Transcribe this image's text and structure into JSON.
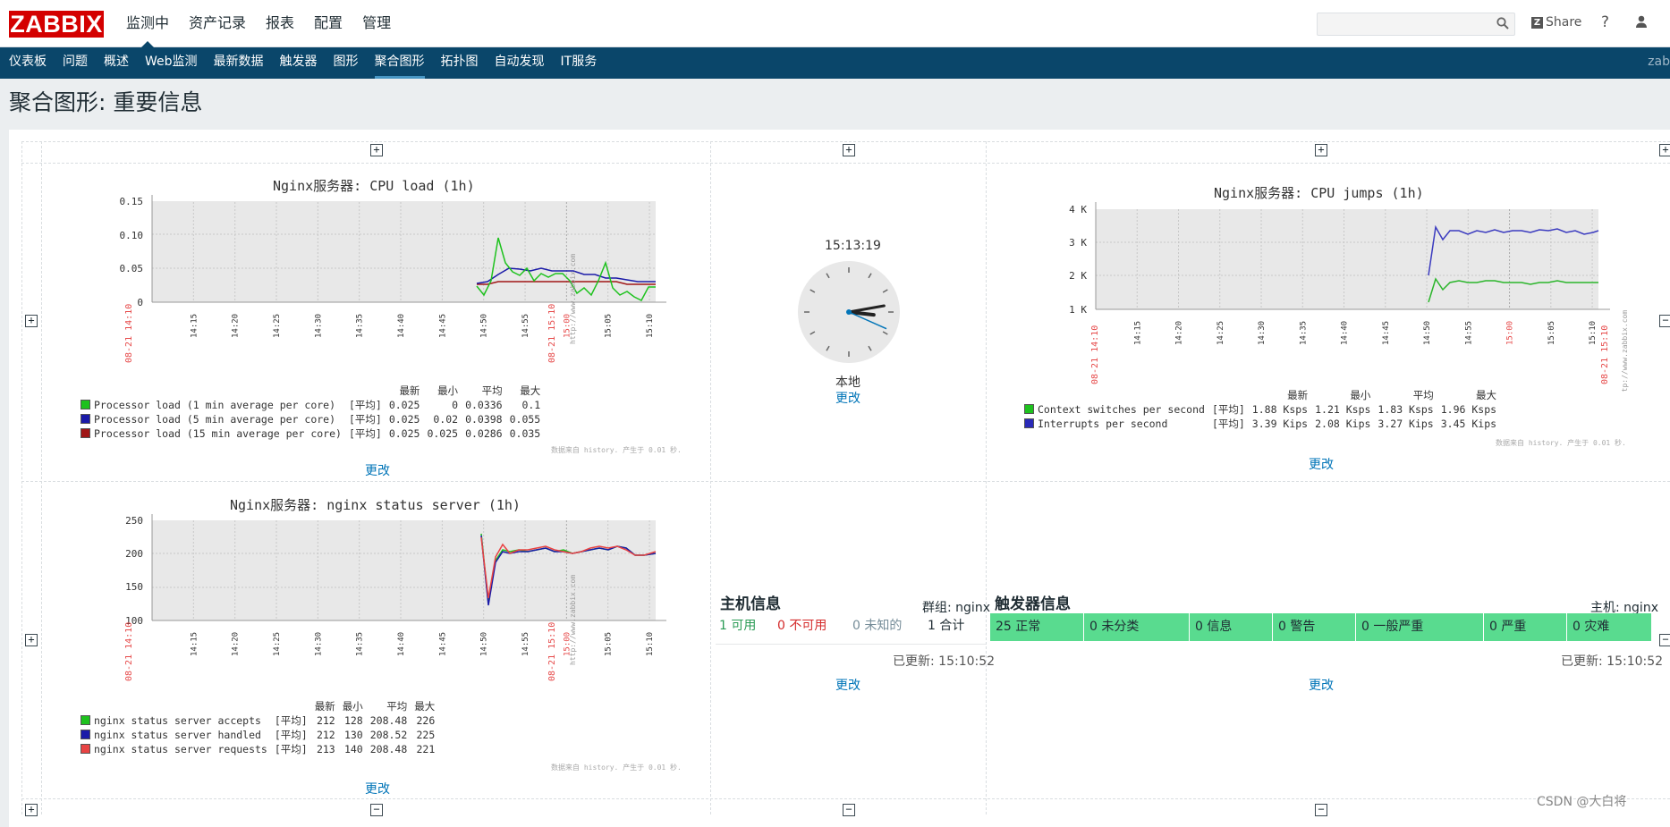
{
  "logo": "ZABBIX",
  "top_menu": [
    {
      "label": "监测中",
      "active": true
    },
    {
      "label": "资产记录"
    },
    {
      "label": "报表"
    },
    {
      "label": "配置"
    },
    {
      "label": "管理"
    }
  ],
  "header_right": {
    "share": "Share",
    "help": "?"
  },
  "sub_menu": [
    {
      "label": "仪表板"
    },
    {
      "label": "问题"
    },
    {
      "label": "概述"
    },
    {
      "label": "Web监测"
    },
    {
      "label": "最新数据"
    },
    {
      "label": "触发器"
    },
    {
      "label": "图形"
    },
    {
      "label": "聚合图形",
      "active": true
    },
    {
      "label": "拓扑图"
    },
    {
      "label": "自动发现"
    },
    {
      "label": "IT服务"
    }
  ],
  "sub_menu_right": "zab",
  "page_title": "聚合图形: 重要信息",
  "change_label": "更改",
  "legend_headers": {
    "last": "最新",
    "min": "最小",
    "avg": "平均",
    "max": "最大"
  },
  "avg_tag": "[平均]",
  "time_ticks": [
    "14:15",
    "14:20",
    "14:25",
    "14:30",
    "14:35",
    "14:40",
    "14:45",
    "14:50",
    "14:55",
    "15:00",
    "15:05",
    "15:10"
  ],
  "time_start": "08-21 14:10",
  "time_end": "08-21 15:10",
  "url_vertical": "http://www.zabbix.com",
  "generated_note": "数据来自 history. 产生于 0.01 秒.",
  "charts": {
    "cpu_load": {
      "title": "Nginx服务器: CPU load (1h)",
      "y_ticks": [
        "0.15",
        "0.10",
        "0.05",
        "0"
      ],
      "items": [
        {
          "name": "Processor load (1 min average per core)",
          "color": "#1ec21e",
          "last": "0.025",
          "min": "0",
          "avg": "0.0336",
          "max": "0.1"
        },
        {
          "name": "Processor load (5 min average per core)",
          "color": "#1a1aa8",
          "last": "0.025",
          "min": "0.02",
          "avg": "0.0398",
          "max": "0.055"
        },
        {
          "name": "Processor load (15 min average per core)",
          "color": "#a01616",
          "last": "0.025",
          "min": "0.025",
          "avg": "0.0286",
          "max": "0.035"
        }
      ]
    },
    "cpu_jumps": {
      "title": "Nginx服务器: CPU jumps (1h)",
      "y_ticks": [
        "4 K",
        "3 K",
        "2 K",
        "1 K"
      ],
      "items": [
        {
          "name": "Context switches per second",
          "color": "#1ec21e",
          "last": "1.88 Ksps",
          "min": "1.21 Ksps",
          "avg": "1.83 Ksps",
          "max": "1.96 Ksps"
        },
        {
          "name": "Interrupts per second",
          "color": "#2a2ab8",
          "last": "3.39 Kips",
          "min": "2.08 Kips",
          "avg": "3.27 Kips",
          "max": "3.45 Kips"
        }
      ]
    },
    "nginx_status": {
      "title": "Nginx服务器: nginx status server (1h)",
      "y_ticks": [
        "250",
        "200",
        "150",
        "100"
      ],
      "items": [
        {
          "name": "nginx status server accepts",
          "color": "#1ec21e",
          "last": "212",
          "min": "128",
          "avg": "208.48",
          "max": "226"
        },
        {
          "name": "nginx status server handled",
          "color": "#1a1aa8",
          "last": "212",
          "min": "130",
          "avg": "208.52",
          "max": "225"
        },
        {
          "name": "nginx status server requests",
          "color": "#e84343",
          "last": "213",
          "min": "140",
          "avg": "208.48",
          "max": "221"
        }
      ]
    }
  },
  "clock": {
    "time": "15:13:19",
    "label": "本地",
    "hours": 15,
    "minutes": 13,
    "seconds": 19
  },
  "host_info": {
    "title": "主机信息",
    "group_label": "群组: nginx",
    "available": "1 可用",
    "unavailable": "0 不可用",
    "unknown": "0 未知的",
    "total": "1 合计",
    "updated": "已更新: 15:10:52"
  },
  "trigger_info": {
    "title": "触发器信息",
    "host_label": "主机: nginx",
    "cells": [
      "25 正常",
      "0 未分类",
      "0 信息",
      "0 警告",
      "0 一般严重",
      "0 严重",
      "0 灾难"
    ],
    "updated": "已更新: 15:10:52"
  },
  "watermark": "CSDN @大白将"
}
